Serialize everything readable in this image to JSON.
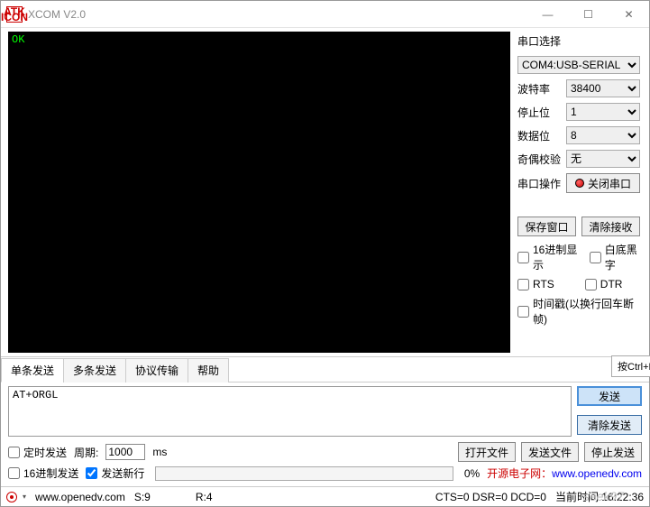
{
  "titlebar": {
    "title": "XCOM V2.0"
  },
  "console": {
    "text": "OK"
  },
  "side": {
    "section_label": "串口选择",
    "port_value": "COM4:USB-SERIAL",
    "baud_label": "波特率",
    "baud_value": "38400",
    "stop_label": "停止位",
    "stop_value": "1",
    "data_label": "数据位",
    "data_value": "8",
    "parity_label": "奇偶校验",
    "parity_value": "无",
    "port_op_label": "串口操作",
    "close_port_btn": "关闭串口",
    "save_window_btn": "保存窗口",
    "clear_recv_btn": "清除接收",
    "hex_display": "16进制显示",
    "white_black": "白底黑字",
    "rts": "RTS",
    "dtr": "DTR",
    "timestamp": "时间戳(以换行回车断帧)"
  },
  "tabs": {
    "t0": "单条发送",
    "t1": "多条发送",
    "t2": "协议传输",
    "t3": "帮助",
    "hint": "按Ctrl+En"
  },
  "send": {
    "text": "AT+ORGL",
    "send_btn": "发送",
    "clear_btn": "清除发送"
  },
  "opts": {
    "timed_send": "定时发送",
    "period_label": "周期:",
    "period_value": "1000",
    "period_unit": "ms",
    "open_file": "打开文件",
    "send_file": "发送文件",
    "stop_send": "停止发送",
    "hex_send": "16进制发送",
    "send_newline": "发送新行",
    "progress_pct": "0%",
    "link_prefix": "开源电子网：",
    "link_url": "www.openedv.com"
  },
  "status": {
    "url": "www.openedv.com",
    "s": "S:9",
    "r": "R:4",
    "line": "CTS=0 DSR=0 DCD=0",
    "time_label": "当前时间 16:22:36"
  },
  "watermark": "seek97"
}
